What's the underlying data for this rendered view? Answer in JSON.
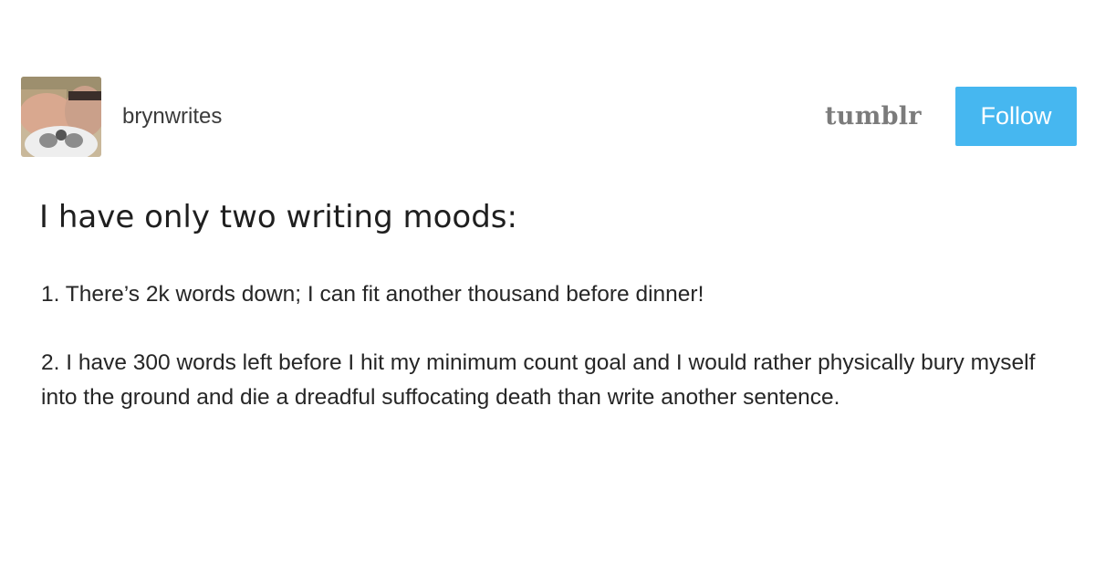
{
  "post": {
    "username": "brynwrites",
    "brand": "tumblr",
    "follow_label": "Follow",
    "headline": "I have only two writing moods:",
    "paragraphs": [
      "1. There’s 2k words down; I can fit another thousand before dinner!",
      "2. I have 300 words left before I hit my minimum count goal and I would rather physically bury myself into the ground and die a dreadful suffocating death than write another sentence."
    ]
  },
  "colors": {
    "follow_button": "#46b7f0",
    "brand_text": "#7b7b7b",
    "body_text": "#262626"
  },
  "icons": {
    "avatar": "avatar-photo"
  }
}
